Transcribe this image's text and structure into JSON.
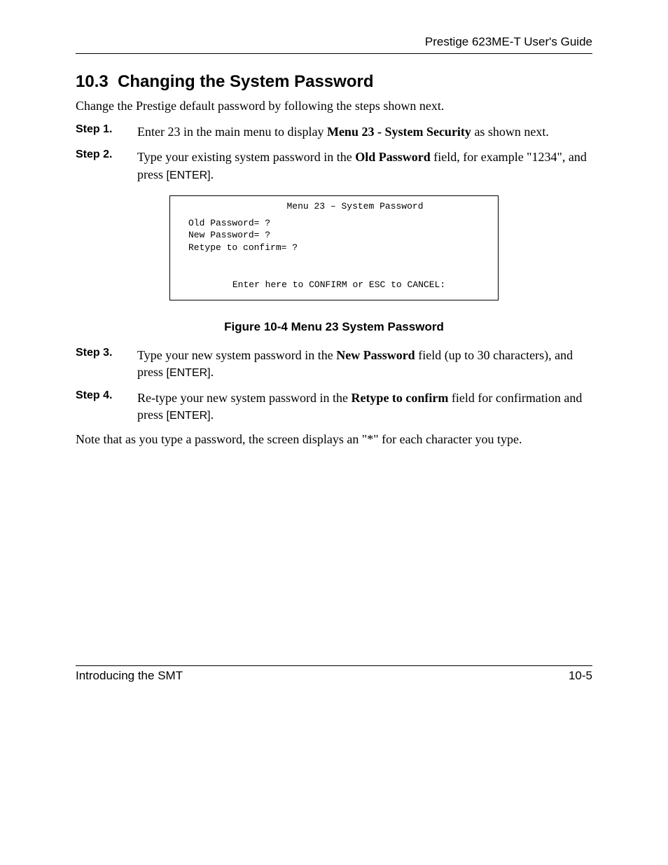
{
  "header": {
    "guide_title": "Prestige 623ME-T User's Guide"
  },
  "section": {
    "number": "10.3",
    "title": "Changing the System Password",
    "intro": "Change the Prestige default password by following the steps shown next."
  },
  "steps": {
    "s1": {
      "label": "Step 1.",
      "t1": "Enter 23 in the main menu to display ",
      "bold1": "Menu 23 - System Security",
      "t2": " as shown next."
    },
    "s2": {
      "label": "Step 2.",
      "t1": "Type your existing system password in the ",
      "bold1": "Old Password",
      "t2": " field, for example \"1234\", and press ",
      "key": "[ENTER]",
      "t3": "."
    },
    "s3": {
      "label": "Step 3.",
      "t1": "Type your new system password in the ",
      "bold1": "New Password",
      "t2": " field (up to 30 characters), and press ",
      "key": "[ENTER]",
      "t3": "."
    },
    "s4": {
      "label": "Step 4.",
      "t1": "Re-type your new system password in the ",
      "bold1": "Retype to confirm",
      "t2": " field for confirmation and press ",
      "key": "[ENTER]",
      "t3": "."
    }
  },
  "figure": {
    "title": "Menu 23 – System Password",
    "line1": "Old Password= ?",
    "line2": "New Password= ?",
    "line3": "Retype to confirm= ?",
    "footer": "Enter here to CONFIRM or ESC to CANCEL:",
    "caption": "Figure 10-4 Menu 23 System Password"
  },
  "note": "Note that as you type a password, the screen displays an \"*\" for each character you type.",
  "footer": {
    "left": "Introducing the SMT",
    "right": "10-5"
  }
}
